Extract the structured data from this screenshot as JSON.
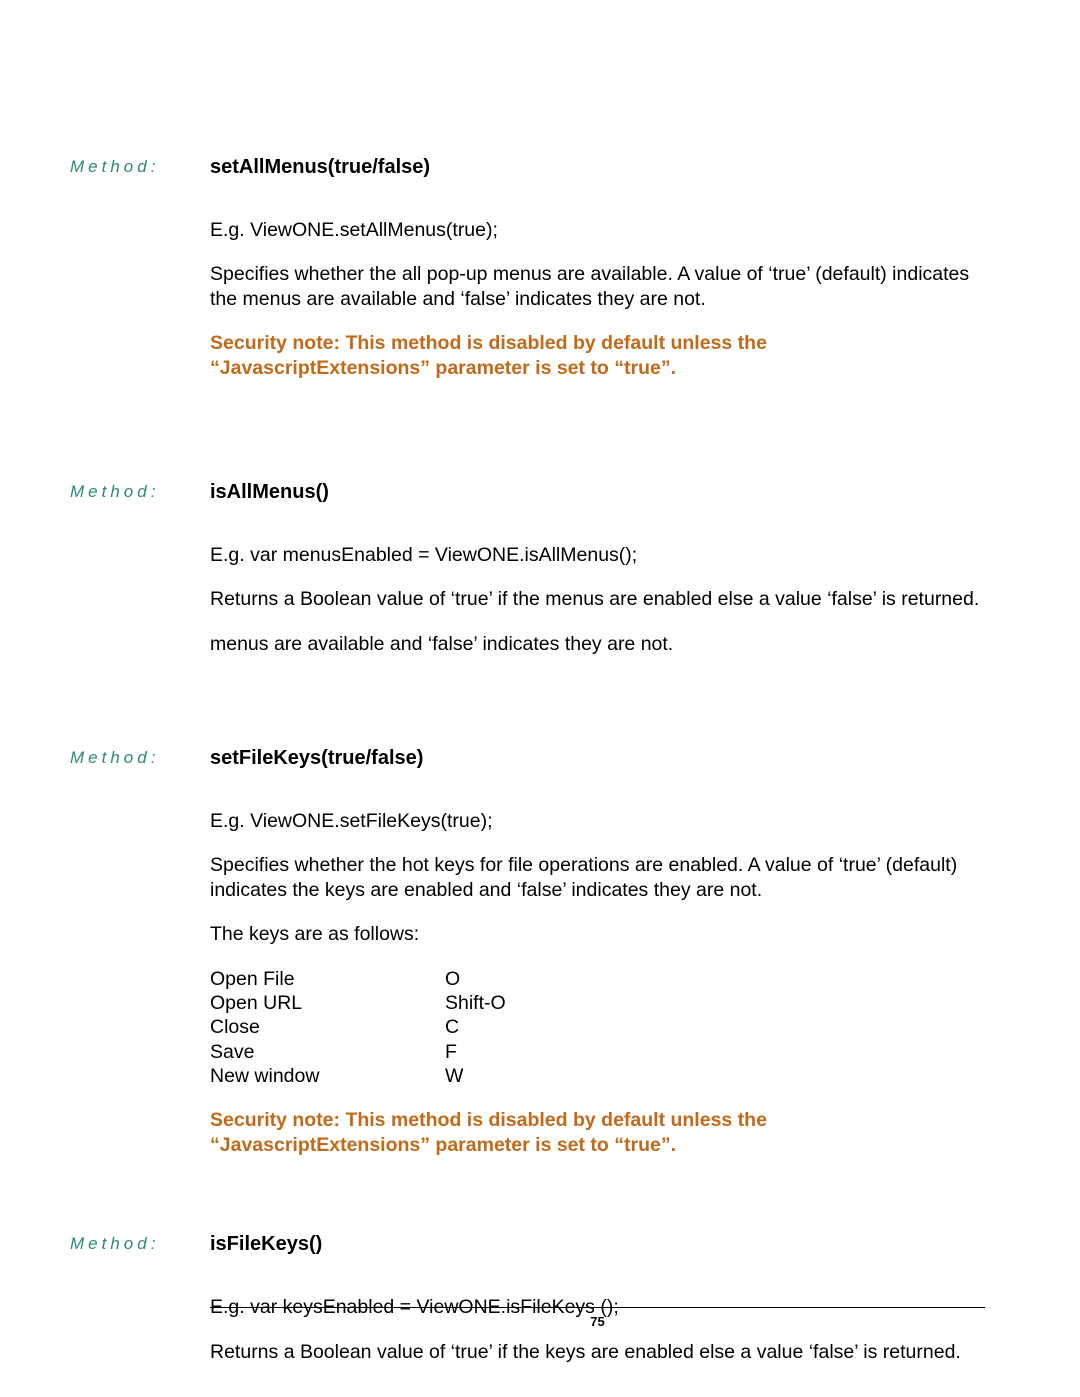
{
  "label": "Method:",
  "pageNumber": "75",
  "securityNote": "Security note: This method is disabled by default unless the “JavascriptExtensions” parameter is set to “true”.",
  "methods": [
    {
      "title": "setAllMenus(true/false)",
      "example": "E.g. ViewONE.setAllMenus(true);",
      "desc": "Specifies whether the all pop-up menus are available. A value of  ‘true’ (default) indicates the menus are available and ‘false’ indicates they are not.",
      "hasSecurity": true
    },
    {
      "title": "isAllMenus()",
      "example": "E.g. var menusEnabled = ViewONE.isAllMenus();",
      "desc": "Returns a Boolean value of ‘true’ if the menus are enabled else a value ‘false’ is returned.",
      "extra": "menus are available and ‘false’ indicates they are not.",
      "hasSecurity": false
    },
    {
      "title": "setFileKeys(true/false)",
      "example": "E.g. ViewONE.setFileKeys(true);",
      "desc": "Specifies whether the hot keys for file operations are enabled. A value of  ‘true’ (default) indicates the keys are enabled and ‘false’ indicates they are not.",
      "keysIntro": "The keys are as follows:",
      "keys": [
        {
          "name": "Open File",
          "shortcut": "O"
        },
        {
          "name": "Open URL",
          "shortcut": "Shift-O"
        },
        {
          "name": "Close",
          "shortcut": "C"
        },
        {
          "name": "Save",
          "shortcut": "F"
        },
        {
          "name": "New window",
          "shortcut": "W"
        }
      ],
      "hasSecurity": true
    },
    {
      "title": "isFileKeys()",
      "example": "E.g. var keysEnabled = ViewONE.isFileKeys ();",
      "desc": "Returns a Boolean value of ‘true’ if the keys are enabled else a value ‘false’ is returned.",
      "hasSecurity": false
    }
  ]
}
